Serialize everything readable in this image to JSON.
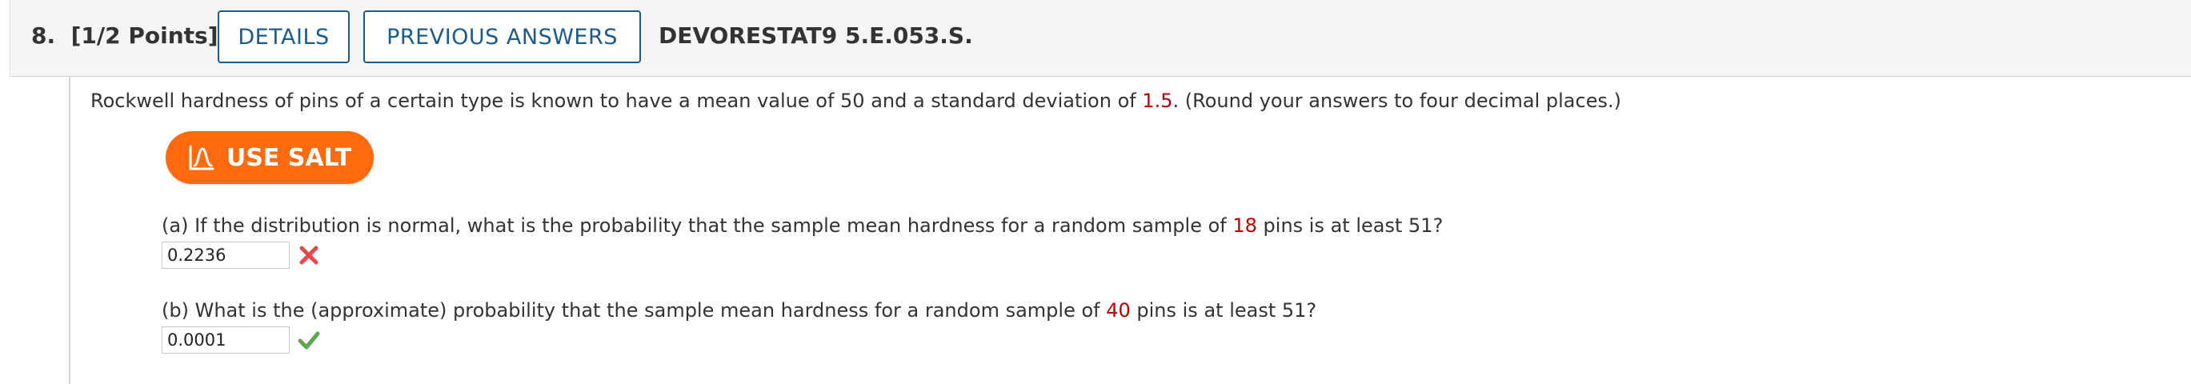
{
  "header": {
    "question_number": "8.",
    "points": "[1/2 Points]",
    "details_label": "DETAILS",
    "previous_answers_label": "PREVIOUS ANSWERS",
    "problem_code": "DEVORESTAT9 5.E.053.S."
  },
  "question": {
    "text_before": "Rockwell hardness of pins of a certain type is known to have a mean value of 50 and a standard deviation of ",
    "std_dev": "1.5",
    "text_after": ". (Round your answers to four decimal places.)"
  },
  "salt_button": {
    "label": "USE SALT",
    "icon": "salt-icon",
    "color": "#ff6a0e"
  },
  "parts": [
    {
      "text_before": "(a) If the distribution is normal, what is the probability that the sample mean hardness for a random sample of ",
      "sample_size": "18",
      "text_after": " pins is at least 51?",
      "answer": "0.2236",
      "status": "incorrect",
      "status_icon": "x-mark-icon",
      "status_color": "#e8474b"
    },
    {
      "text_before": "(b) What is the (approximate) probability that the sample mean hardness for a random sample of ",
      "sample_size": "40",
      "text_after": " pins is at least 51?",
      "answer": "0.0001",
      "status": "correct",
      "status_icon": "check-mark-icon",
      "status_color": "#5aa84b"
    }
  ],
  "colors": {
    "accent_blue": "#1c5b8a",
    "highlight_red": "#c00000"
  }
}
